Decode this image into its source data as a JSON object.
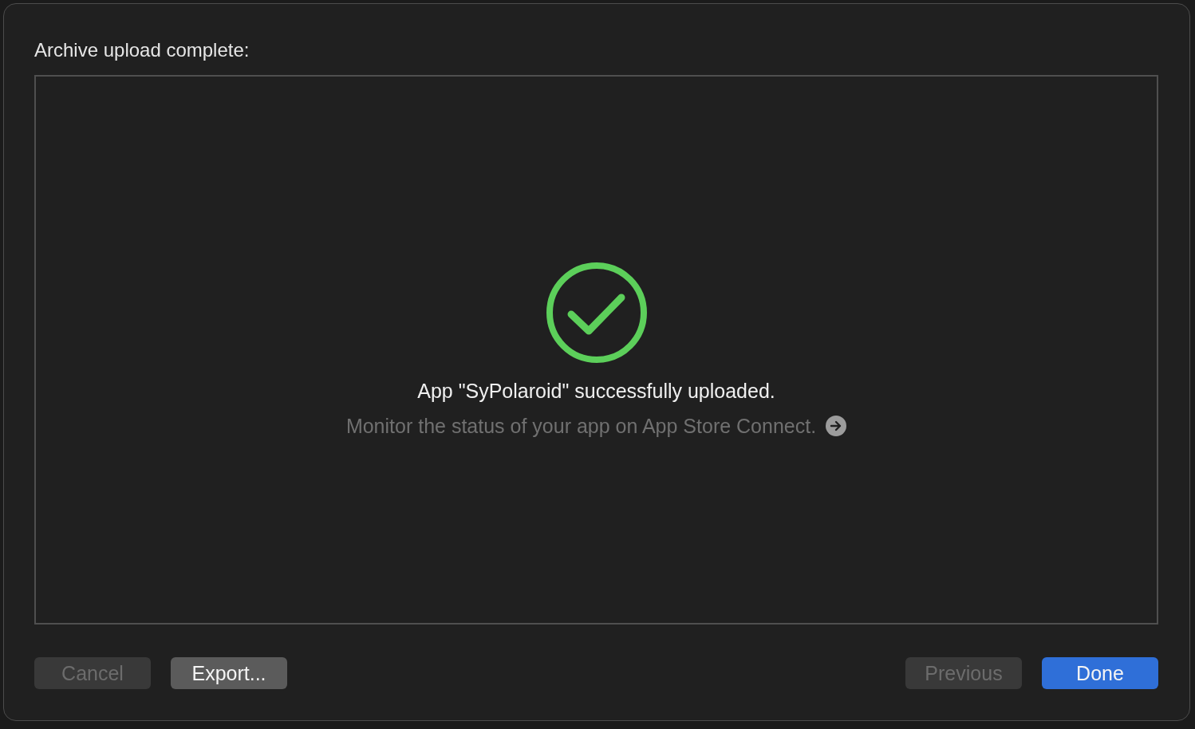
{
  "sheet": {
    "title": "Archive upload complete:"
  },
  "result": {
    "message": "App \"SyPolaroid\" successfully uploaded.",
    "detail": "Monitor the status of your app on App Store Connect."
  },
  "buttons_left": [
    {
      "label": "Cancel",
      "kind": "push",
      "disabled": true
    },
    {
      "label": "Export...",
      "kind": "push",
      "disabled": false
    }
  ],
  "buttons_right": [
    {
      "label": "Previous",
      "kind": "push",
      "disabled": true
    },
    {
      "label": "Done",
      "kind": "default",
      "disabled": false
    }
  ]
}
